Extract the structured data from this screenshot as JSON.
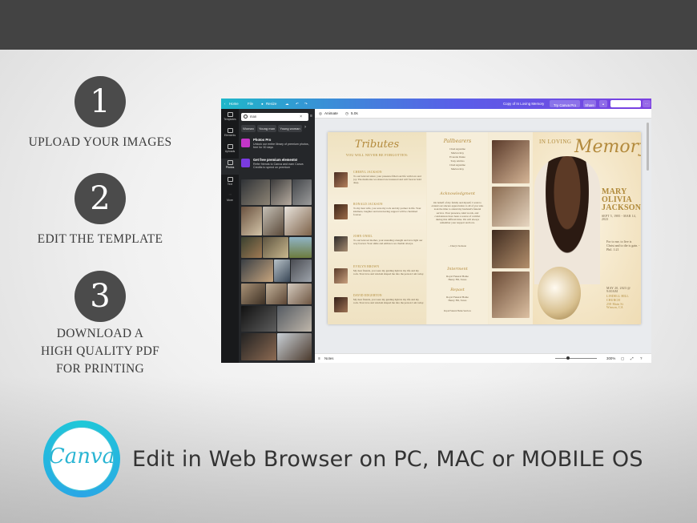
{
  "steps": [
    {
      "number": "1",
      "text": "UPLOAD YOUR IMAGES"
    },
    {
      "number": "2",
      "text": "EDIT THE TEMPLATE"
    },
    {
      "number": "3",
      "text": "DOWNLOAD A\nHIGH QUALITY PDF\nFOR PRINTING"
    }
  ],
  "brand": {
    "logo_text": "Canva",
    "tagline": "Edit in Web Browser on PC, MAC or MOBILE OS",
    "accent": "#1fc8d8"
  },
  "editor": {
    "topbar": {
      "home": "Home",
      "file": "File",
      "notes_resize": "Resize",
      "doc_title": "Copy of In Loving Memory",
      "try_pro": "Try Canva Pro",
      "share": "Share",
      "download": "Download"
    },
    "rail": [
      "Templates",
      "Elements",
      "Uploads",
      "Photos",
      "Text",
      "More"
    ],
    "search": {
      "value": "man"
    },
    "chips": [
      "Woman",
      "Young man",
      "Young woman"
    ],
    "promos": [
      {
        "title": "Photos Pro",
        "body": "Unlock our entire library of premium photos, free for 30 days"
      },
      {
        "title": "Get free premium elements!",
        "body": "Refer friends to Canva and earn Canva Credits to spend on premium"
      }
    ],
    "canvas_toolbar": {
      "animate": "Animate",
      "duration": "5.0s"
    },
    "bottombar": {
      "notes": "Notes",
      "zoom": "300%"
    }
  },
  "program": {
    "tributes_title": "Tributes",
    "tributes_subtitle": "YOU WILL NEVER BE FORGOTTEN:",
    "tributes": [
      {
        "name": "CHERYL JACKSON",
        "text": "To our beloved sister, your presence filled our life with love and joy. The memories we shared are treasured and will forever hold deep."
      },
      {
        "name": "RONALD JACKSON",
        "text": "To my dear wife, you were my rock and my partner in life. Your kindness, laughter and unwavering support will be cherished forever."
      },
      {
        "name": "JOHN ONEIL",
        "text": "To our beloved mother, your unending strength and love light our way forever. Your smile and embrace we cherish always."
      },
      {
        "name": "EVELYN BROWN",
        "text": "My dear friends, you were my guiding light in my life and my rock. Your love and wisdom shaped me into the person I am today."
      },
      {
        "name": "DAVID EDGERTON",
        "text": "My dear friends, you were my guiding light in my life and my rock. Your love and wisdom shaped me into the person I am today."
      }
    ],
    "pallbearers_title": "Pallbearers",
    "pallbearers": [
      "Chud Agustine",
      "Marlon Roy",
      "Everette Dante",
      "Tony Alcrino",
      "Chud Agustine",
      "Marlon Roy"
    ],
    "ack_title": "Acknowledgment",
    "ack_text": "On behalf of my family and myself, I want to extend our sincere appreciation to all of you who took the time to attend my husband's funeral service. Your presence, kind words, and condolences have been a source of comfort during this difficult time. We will always remember your support and love.",
    "ack_sign": "- Cheryl Jackson",
    "interment_title": "Interment",
    "interment": "Royal Funeral Home\nHenry Fill, Texas",
    "repast_title": "Repast",
    "repast": "Royal Funeral Home\nHenry Fill, Texas",
    "footer_small": "Royal Funeral Home Services",
    "cover_in_loving": "IN LOVING",
    "cover_memory": "Memory",
    "cover_name": [
      "MARY",
      "OLIVIA",
      "JACKSON"
    ],
    "cover_dates": "SEPT 5, 1985 - MAR 14, 2023",
    "cover_verse": "For to me, to live is Christ and to die is gain. - Phil. 1:21",
    "cover_service": "MAY 20, 2023 @ 9:00AM",
    "cover_location": "LINDELL HILL\nCHURCH\n258 Main St\nWinson, CA"
  }
}
